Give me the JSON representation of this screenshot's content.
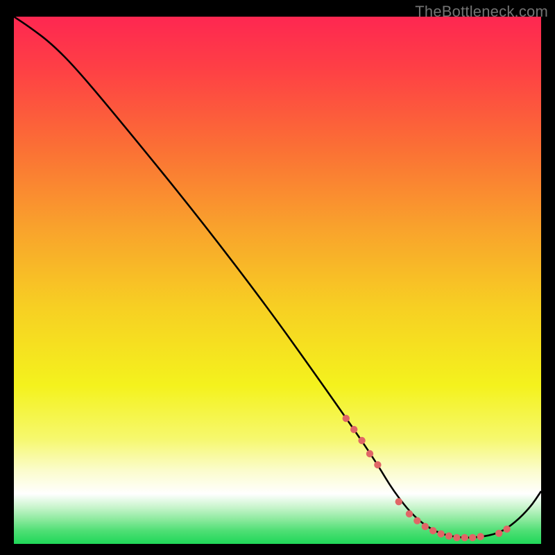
{
  "watermark": "TheBottleneck.com",
  "colors": {
    "frame_bg": "#000000",
    "curve_stroke": "#000000",
    "dot_fill": "#e06666",
    "watermark_text": "#737373",
    "gradient_stops": [
      {
        "offset": 0.0,
        "color": "#fe2751"
      },
      {
        "offset": 0.1,
        "color": "#fe4045"
      },
      {
        "offset": 0.25,
        "color": "#fb7035"
      },
      {
        "offset": 0.4,
        "color": "#f9a22c"
      },
      {
        "offset": 0.55,
        "color": "#f7cf23"
      },
      {
        "offset": 0.7,
        "color": "#f4f21d"
      },
      {
        "offset": 0.8,
        "color": "#f6f86d"
      },
      {
        "offset": 0.86,
        "color": "#fbfccb"
      },
      {
        "offset": 0.905,
        "color": "#ffffff"
      },
      {
        "offset": 0.93,
        "color": "#c9f5cd"
      },
      {
        "offset": 0.955,
        "color": "#88e99b"
      },
      {
        "offset": 0.975,
        "color": "#4fdf75"
      },
      {
        "offset": 1.0,
        "color": "#1fd758"
      }
    ]
  },
  "chart_data": {
    "type": "line",
    "title": "",
    "xlabel": "",
    "ylabel": "",
    "xlim": [
      0,
      100
    ],
    "ylim": [
      0,
      100
    ],
    "legend": false,
    "grid": false,
    "series": [
      {
        "name": "bottleneck-curve",
        "x": [
          0,
          3,
          7,
          12,
          22,
          35,
          48,
          58,
          65,
          69,
          72,
          76,
          80,
          84,
          88,
          92,
          95,
          98,
          100
        ],
        "y": [
          100,
          98,
          95,
          90,
          78,
          62,
          45,
          31,
          21,
          15,
          10,
          5,
          2.2,
          1.2,
          1.2,
          2.0,
          4.0,
          7.0,
          10
        ]
      }
    ],
    "markers": [
      {
        "x": 63,
        "y": 23.8
      },
      {
        "x": 64.5,
        "y": 21.7
      },
      {
        "x": 66,
        "y": 19.6
      },
      {
        "x": 67.5,
        "y": 17.1
      },
      {
        "x": 69,
        "y": 15.0
      },
      {
        "x": 73,
        "y": 8.0
      },
      {
        "x": 75,
        "y": 5.7
      },
      {
        "x": 76.5,
        "y": 4.4
      },
      {
        "x": 78,
        "y": 3.3
      },
      {
        "x": 79.5,
        "y": 2.5
      },
      {
        "x": 81,
        "y": 1.9
      },
      {
        "x": 82.5,
        "y": 1.5
      },
      {
        "x": 84,
        "y": 1.2
      },
      {
        "x": 85.5,
        "y": 1.2
      },
      {
        "x": 87,
        "y": 1.2
      },
      {
        "x": 88.5,
        "y": 1.4
      },
      {
        "x": 92,
        "y": 2.0
      },
      {
        "x": 93.5,
        "y": 2.8
      }
    ]
  }
}
